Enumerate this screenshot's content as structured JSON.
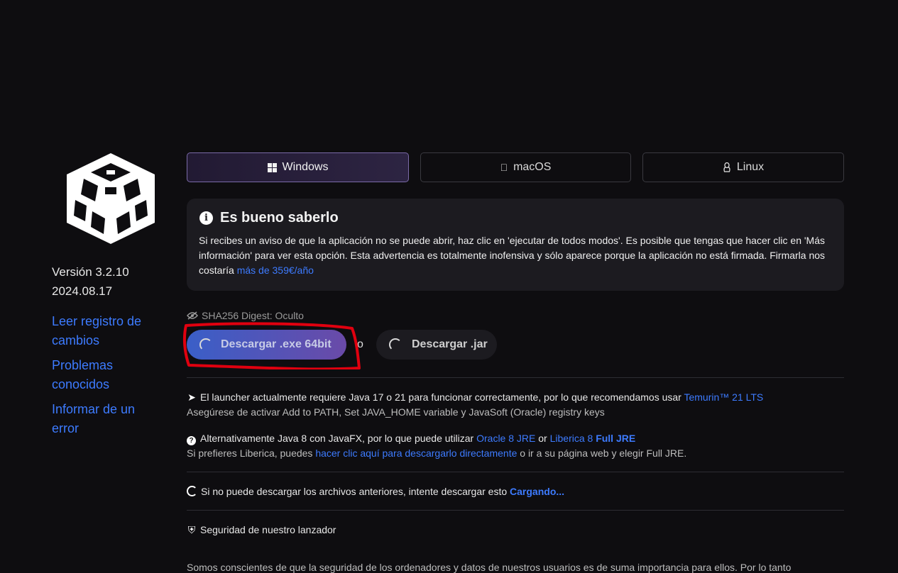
{
  "sidebar": {
    "version": "Versión 3.2.10",
    "date": "2024.08.17",
    "links": [
      "Leer registro de cambios",
      "Problemas conocidos",
      "Informar de un error"
    ]
  },
  "tabs": [
    {
      "label": "Windows",
      "icon": "windows-icon",
      "active": true
    },
    {
      "label": "macOS",
      "icon": "apple-icon",
      "active": false
    },
    {
      "label": "Linux",
      "icon": "linux-icon",
      "active": false
    }
  ],
  "notice": {
    "title": "Es bueno saberlo",
    "body": "Si recibes un aviso de que la aplicación no se puede abrir, haz clic en 'ejecutar de todos modos'. Es posible que tengas que hacer clic en 'Más información' para ver esta opción. Esta advertencia es totalmente inofensiva y sólo aparece porque la aplicación no está firmada. Firmarla nos costaría",
    "link": "más de 359€/año"
  },
  "sha": "SHA256 Digest: Oculto",
  "download": {
    "exe_label": "Descargar .exe 64bit",
    "or": "o",
    "jar_label": "Descargar .jar"
  },
  "java": {
    "line1": "El launcher actualmente requiere Java 17 o 21 para funcionar correctamente, por lo que recomendamos usar",
    "temurin_link": "Temurin™ 21 LTS",
    "line1_sub": "Asegúrese de activar Add to PATH, Set JAVA_HOME variable y JavaSoft (Oracle) registry keys",
    "line2": "Alternativamente Java 8 con JavaFX, por lo que puede utilizar",
    "oracle_link": "Oracle 8 JRE",
    "line2_or": "or",
    "liberica_link": "Liberica 8",
    "liberica_bold": "Full JRE",
    "line2_sub_pre": "Si prefieres Liberica, puedes",
    "line2_sub_link": "hacer clic aquí para descargarlo directamente",
    "line2_sub_post": "o ir a su página web y elegir Full JRE."
  },
  "alt_download": {
    "text": "Si no puede descargar los archivos anteriores, intente descargar esto",
    "link": "Cargando..."
  },
  "security": {
    "title": "Seguridad de nuestro lanzador",
    "body_cut": "Somos conscientes de que la seguridad de los ordenadores y datos de nuestros usuarios es de suma importancia para ellos. Por lo tanto"
  },
  "colors": {
    "accent": "#3d7bff",
    "background": "#0e0d10",
    "annotation": "#e0000f"
  }
}
